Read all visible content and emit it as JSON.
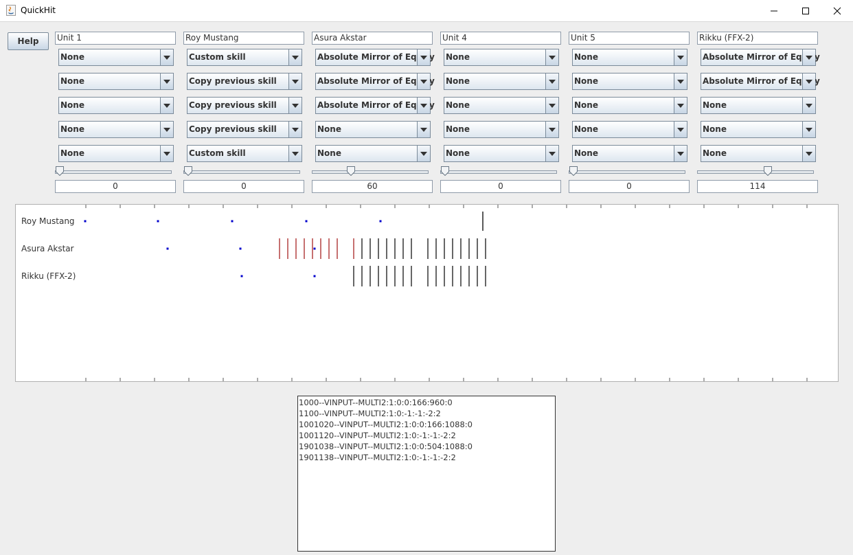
{
  "window": {
    "title": "QuickHit"
  },
  "help_label": "Help",
  "units": [
    {
      "name": "Unit 1",
      "skills": [
        "None",
        "None",
        "None",
        "None",
        "None"
      ],
      "slider_value": "0",
      "slider_fraction": 0.0
    },
    {
      "name": "Roy Mustang",
      "skills": [
        "Custom skill",
        "Copy previous skill",
        "Copy previous skill",
        "Copy previous skill",
        "Custom skill"
      ],
      "slider_value": "0",
      "slider_fraction": 0.0
    },
    {
      "name": "Asura Akstar",
      "skills": [
        "Absolute Mirror of Equity",
        "Absolute Mirror of Equity",
        "Absolute Mirror of Equity",
        "None",
        "None"
      ],
      "slider_value": "60",
      "slider_fraction": 0.3
    },
    {
      "name": "Unit 4",
      "skills": [
        "None",
        "None",
        "None",
        "None",
        "None"
      ],
      "slider_value": "0",
      "slider_fraction": 0.0
    },
    {
      "name": "Unit 5",
      "skills": [
        "None",
        "None",
        "None",
        "None",
        "None"
      ],
      "slider_value": "0",
      "slider_fraction": 0.0
    },
    {
      "name": "Rikku (FFX-2)",
      "skills": [
        "Absolute Mirror of Equity",
        "Absolute Mirror of Equity",
        "None",
        "None",
        "None"
      ],
      "slider_value": "114",
      "slider_fraction": 0.57
    }
  ],
  "timeline": {
    "rows": [
      "Roy Mustang",
      "Asura Akstar",
      "Rikku (FFX-2)"
    ]
  },
  "log_lines": [
    "1000--VINPUT--MULTI2:1:0:0:166:960:0",
    "1100--VINPUT--MULTI2:1:0:-1:-1:-2:2",
    "1001020--VINPUT--MULTI2:1:0:0:166:1088:0",
    "1001120--VINPUT--MULTI2:1:0:-1:-1:-2:2",
    "1901038--VINPUT--MULTI2:1:0:0:504:1088:0",
    "1901138--VINPUT--MULTI2:1:0:-1:-1:-2:2"
  ],
  "colors": {
    "dot": "#0000cc",
    "hit_red": "#a01010",
    "hit_black": "#000000"
  }
}
